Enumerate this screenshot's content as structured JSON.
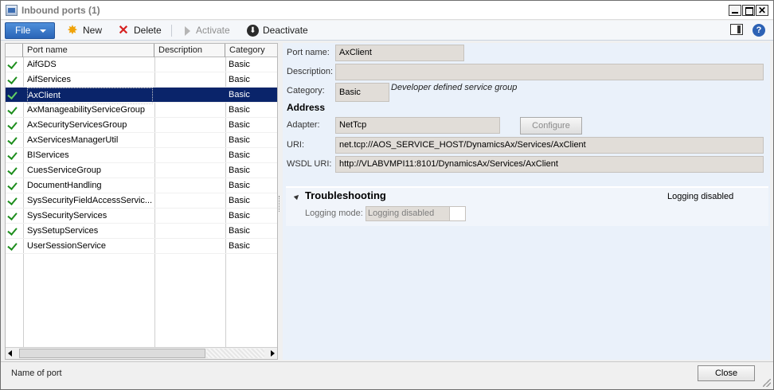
{
  "window": {
    "title": "Inbound ports (1)",
    "controls": {
      "minimize": "_",
      "maximize": "□",
      "close": "✕"
    }
  },
  "toolbar": {
    "file_label": "File",
    "new_label": "New",
    "delete_label": "Delete",
    "activate_label": "Activate",
    "deactivate_label": "Deactivate",
    "help_label": "?"
  },
  "grid": {
    "columns": [
      "Port name",
      "Description",
      "Category"
    ],
    "rows": [
      {
        "name": "AifGDS",
        "description": "",
        "category": "Basic",
        "active": true
      },
      {
        "name": "AifServices",
        "description": "",
        "category": "Basic",
        "active": true
      },
      {
        "name": "AxClient",
        "description": "",
        "category": "Basic",
        "active": true,
        "selected": true
      },
      {
        "name": "AxManageabilityServiceGroup",
        "description": "",
        "category": "Basic",
        "active": true
      },
      {
        "name": "AxSecurityServicesGroup",
        "description": "",
        "category": "Basic",
        "active": true
      },
      {
        "name": "AxServicesManagerUtil",
        "description": "",
        "category": "Basic",
        "active": true
      },
      {
        "name": "BIServices",
        "description": "",
        "category": "Basic",
        "active": true
      },
      {
        "name": "CuesServiceGroup",
        "description": "",
        "category": "Basic",
        "active": true
      },
      {
        "name": "DocumentHandling",
        "description": "",
        "category": "Basic",
        "active": true
      },
      {
        "name": "SysSecurityFieldAccessServic...",
        "description": "",
        "category": "Basic",
        "active": true
      },
      {
        "name": "SysSecurityServices",
        "description": "",
        "category": "Basic",
        "active": true
      },
      {
        "name": "SysSetupServices",
        "description": "",
        "category": "Basic",
        "active": true
      },
      {
        "name": "UserSessionService",
        "description": "",
        "category": "Basic",
        "active": true
      }
    ]
  },
  "detail": {
    "port_name_label": "Port name:",
    "port_name": "AxClient",
    "description_label": "Description:",
    "description": "",
    "category_label": "Category:",
    "category": "Basic",
    "category_note": "Developer defined service group",
    "address_heading": "Address",
    "adapter_label": "Adapter:",
    "adapter": "NetTcp",
    "configure_label": "Configure",
    "uri_label": "URI:",
    "uri": "net.tcp://AOS_SERVICE_HOST/DynamicsAx/Services/AxClient",
    "wsdl_label": "WSDL URI:",
    "wsdl_uri": "http://VLABVMPI11:8101/DynamicsAx/Services/AxClient"
  },
  "troubleshooting": {
    "title": "Troubleshooting",
    "summary": "Logging disabled",
    "logging_mode_label": "Logging mode:",
    "logging_mode": "Logging disabled"
  },
  "status": {
    "text": "Name of port",
    "close_label": "Close"
  }
}
